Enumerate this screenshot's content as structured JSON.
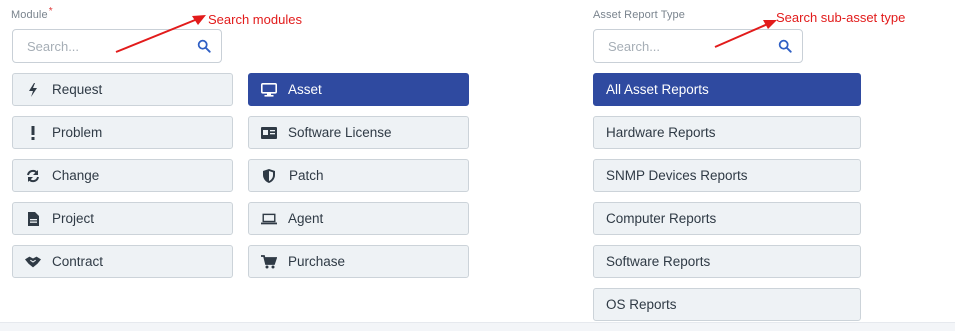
{
  "module": {
    "label": "Module",
    "required_mark": "*",
    "search_placeholder": "Search...",
    "annotation": "Search modules",
    "items": [
      {
        "label": "Request",
        "icon": "bolt-icon",
        "active": false
      },
      {
        "label": "Problem",
        "icon": "exclamation-icon",
        "active": false
      },
      {
        "label": "Change",
        "icon": "refresh-icon",
        "active": false
      },
      {
        "label": "Project",
        "icon": "document-icon",
        "active": false
      },
      {
        "label": "Contract",
        "icon": "handshake-icon",
        "active": false
      },
      {
        "label": "Asset",
        "icon": "monitor-icon",
        "active": true
      },
      {
        "label": "Software License",
        "icon": "id-card-icon",
        "active": false
      },
      {
        "label": "Patch",
        "icon": "shield-icon",
        "active": false
      },
      {
        "label": "Agent",
        "icon": "laptop-icon",
        "active": false
      },
      {
        "label": "Purchase",
        "icon": "cart-icon",
        "active": false
      }
    ]
  },
  "asset_report_type": {
    "label": "Asset Report Type",
    "search_placeholder": "Search...",
    "annotation": "Search sub-asset type",
    "items": [
      {
        "label": "All Asset Reports",
        "active": true
      },
      {
        "label": "Hardware Reports",
        "active": false
      },
      {
        "label": "SNMP Devices Reports",
        "active": false
      },
      {
        "label": "Computer Reports",
        "active": false
      },
      {
        "label": "Software Reports",
        "active": false
      },
      {
        "label": "OS Reports",
        "active": false
      }
    ]
  },
  "colors": {
    "accent": "#2f4aa0",
    "annotation_red": "#e21b1b",
    "button_bg": "#eef2f5"
  }
}
